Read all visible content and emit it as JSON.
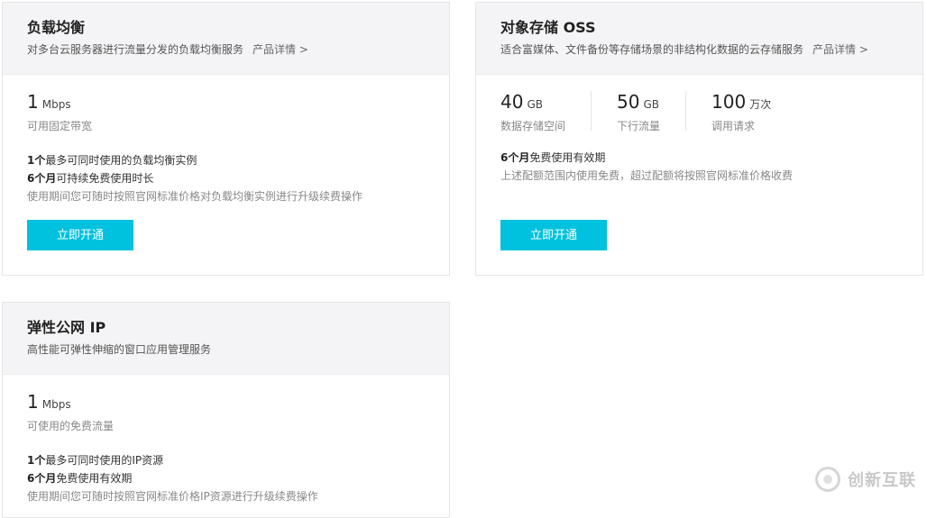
{
  "slb": {
    "title": "负载均衡",
    "desc": "对多台云服务器进行流量分发的负载均衡服务",
    "detail_link": "产品详情 >",
    "bandwidth_num": "1",
    "bandwidth_unit": "Mbps",
    "bandwidth_label": "可用固定带宽",
    "line1_bold": "1个",
    "line1_text": "最多可同时使用的负载均衡实例",
    "line2_bold": "6个月",
    "line2_text": "可持续免费使用时长",
    "line3": "使用期间您可随时按照官网标准价格对负载均衡实例进行升级续费操作",
    "button": "立即开通"
  },
  "oss": {
    "title": "对象存储 OSS",
    "desc": "适合富媒体、文件备份等存储场景的非结构化数据的云存储服务",
    "detail_link": "产品详情 >",
    "metrics": [
      {
        "num": "40",
        "unit": "GB",
        "label": "数据存储空间"
      },
      {
        "num": "50",
        "unit": "GB",
        "label": "下行流量"
      },
      {
        "num": "100",
        "unit": "万次",
        "label": "调用请求"
      }
    ],
    "line1_bold": "6个月",
    "line1_text": "免费使用有效期",
    "line2": "上述配额范围内使用免费，超过配额将按照官网标准价格收费",
    "button": "立即开通"
  },
  "eip": {
    "title": "弹性公网 IP",
    "desc": "高性能可弹性伸缩的窗口应用管理服务",
    "bandwidth_num": "1",
    "bandwidth_unit": "Mbps",
    "bandwidth_label": "可使用的免费流量",
    "line1_bold": "1个",
    "line1_text": "最多可同时使用的IP资源",
    "line2_bold": "6个月",
    "line2_text": "免费使用有效期",
    "line3": "使用期间您可随时按照官网标准价格IP资源进行升级续费操作"
  },
  "watermark": {
    "text": "创新互联"
  }
}
